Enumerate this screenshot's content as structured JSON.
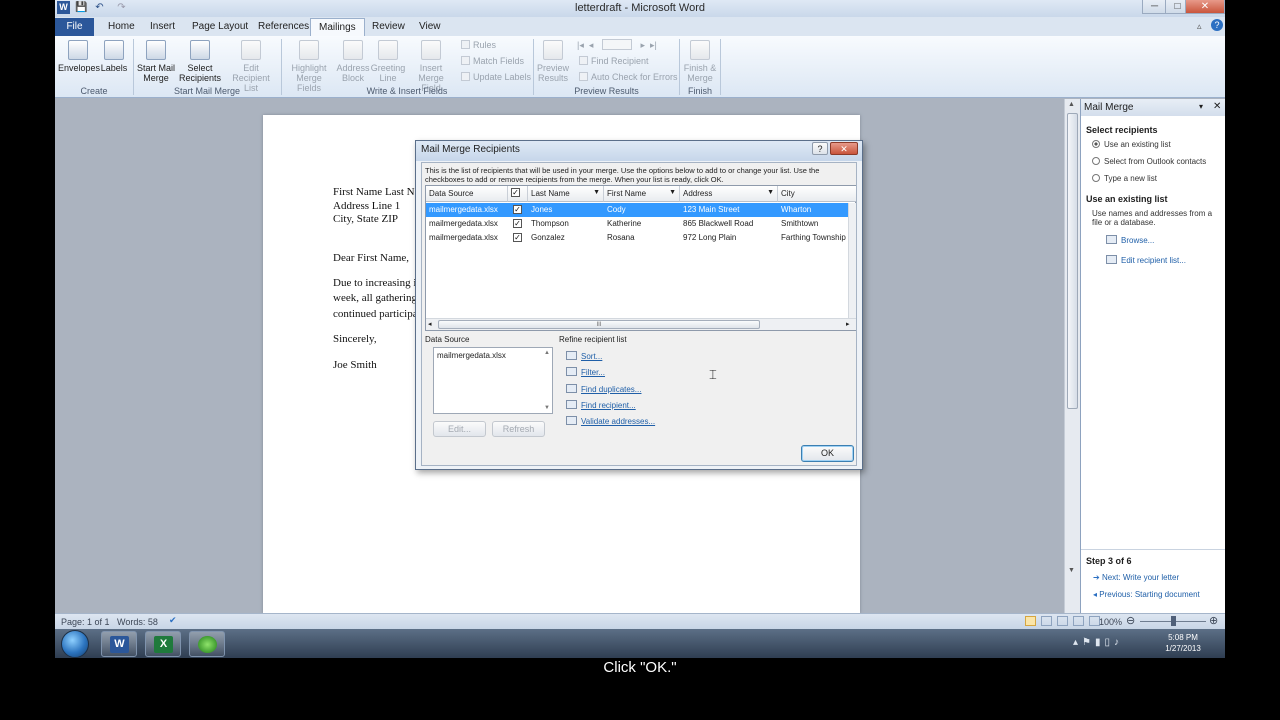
{
  "window": {
    "title": "letterdraft - Microsoft Word",
    "minimize": "─",
    "maximize": "□",
    "close": "✕"
  },
  "quick_access": {
    "save": "💾",
    "undo": "↶",
    "redo": "↷"
  },
  "tabs": [
    "File",
    "Home",
    "Insert",
    "Page Layout",
    "References",
    "Mailings",
    "Review",
    "View"
  ],
  "ribbon": {
    "create": {
      "envelopes": "Envelopes",
      "labels": "Labels",
      "group": "Create"
    },
    "start": {
      "start_merge_1": "Start Mail",
      "start_merge_2": "Merge",
      "select_rec_1": "Select",
      "select_rec_2": "Recipients",
      "edit_list_1": "Edit",
      "edit_list_2": "Recipient List",
      "group": "Start Mail Merge"
    },
    "write": {
      "highlight_1": "Highlight",
      "highlight_2": "Merge Fields",
      "address_1": "Address",
      "address_2": "Block",
      "greeting_1": "Greeting",
      "greeting_2": "Line",
      "insert_1": "Insert Merge",
      "insert_2": "Field",
      "rules": "Rules",
      "match": "Match Fields",
      "update": "Update Labels",
      "group": "Write & Insert Fields"
    },
    "preview": {
      "preview_1": "Preview",
      "preview_2": "Results",
      "find": "Find Recipient",
      "auto": "Auto Check for Errors",
      "group": "Preview Results"
    },
    "finish": {
      "finish_1": "Finish &",
      "finish_2": "Merge",
      "group": "Finish"
    }
  },
  "document": {
    "lines": [
      "First Name Last N",
      "Address Line 1",
      "City, State ZIP",
      "Dear First Name,",
      "Due to increasing interest in our monthly club, we have outgrown our current space. As of next",
      "week, all gatherings will take place at the local diner at 123 Main Street. Thank you for your",
      "continued participation and see you next week!",
      "Sincerely,",
      "Joe Smith"
    ]
  },
  "dialog": {
    "title": "Mail Merge Recipients",
    "help": "?",
    "close": "✕",
    "intro_1": "This is the list of recipients that will be used in your merge.  Use the options below to add to or change your list.  Use the",
    "intro_2": "checkboxes to add or remove recipients from the merge.  When your list is ready, click OK.",
    "columns": [
      "Data Source",
      "",
      "Last Name",
      "First Name",
      "Address",
      "City"
    ],
    "rows": [
      {
        "source": "mailmergedata.xlsx",
        "checked": "✓",
        "last": "Jones",
        "first": "Cody",
        "address": "123 Main Street",
        "city": "Wharton"
      },
      {
        "source": "mailmergedata.xlsx",
        "checked": "✓",
        "last": "Thompson",
        "first": "Katherine",
        "address": "865 Blackwell Road",
        "city": "Smithtown"
      },
      {
        "source": "mailmergedata.xlsx",
        "checked": "✓",
        "last": "Gonzalez",
        "first": "Rosana",
        "address": "972 Long Plain",
        "city": "Farthing Township"
      }
    ],
    "hscroll_grip": "III",
    "data_source_label": "Data Source",
    "data_source_item": "mailmergedata.xlsx",
    "edit": "Edit...",
    "refresh": "Refresh",
    "refine_label": "Refine recipient list",
    "refine": [
      "Sort...",
      "Filter...",
      "Find duplicates...",
      "Find recipient...",
      "Validate addresses..."
    ],
    "ok": "OK"
  },
  "pane": {
    "title": "Mail Merge",
    "select_heading": "Select recipients",
    "options": [
      "Use an existing list",
      "Select from Outlook contacts",
      "Type a new list"
    ],
    "existing_heading": "Use an existing list",
    "existing_desc_1": "Use names and addresses from a",
    "existing_desc_2": "file or a database.",
    "browse": "Browse...",
    "edit_list": "Edit recipient list...",
    "step": "Step 3 of 6",
    "next": "Next: Write your letter",
    "previous": "Previous: Starting document"
  },
  "status": {
    "page": "Page: 1 of 1",
    "words": "Words: 58",
    "zoom": "100%"
  },
  "clock": {
    "time": "5:08 PM",
    "date": "1/27/2013"
  },
  "caption": "Click \"OK.\""
}
